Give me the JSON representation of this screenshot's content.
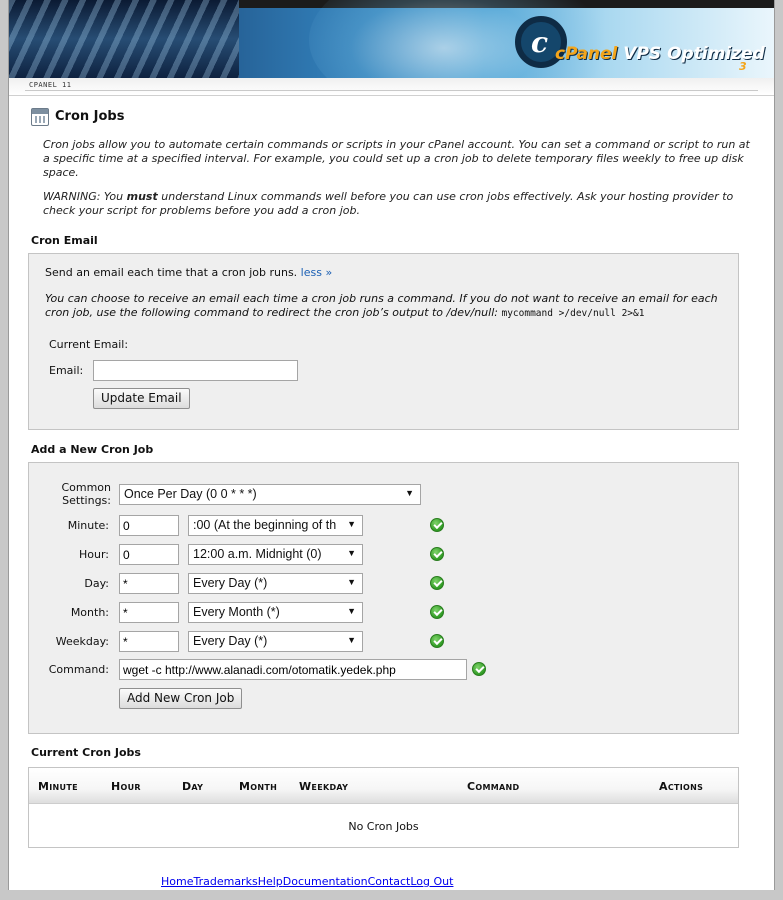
{
  "header": {
    "logo_letter": "c",
    "brand_prefix": "cPanel",
    "brand_suffix": " VPS Optimized",
    "brand_version": "3",
    "cpanel_version_label": "CPANEL 11"
  },
  "page": {
    "title": "Cron Jobs",
    "description": "Cron jobs allow you to automate certain commands or scripts in your cPanel account. You can set a command or script to run at a specific time at a specified interval. For example, you could set up a cron job to delete temporary files weekly to free up disk space.",
    "warning_prefix": "WARNING: You ",
    "warning_emphasis": "must",
    "warning_suffix": " understand Linux commands well before you can use cron jobs effectively. Ask your hosting provider to check your script for problems before you add a cron job."
  },
  "cron_email": {
    "section_title": "Cron Email",
    "intro": "Send an email each time that a cron job runs. ",
    "less_link": "less »",
    "detail": "You can choose to receive an email each time a cron job runs a command. If you do not want to receive an email for each cron job, use the following command to redirect the cron job’s output to /dev/null: ",
    "detail_code": "mycommand >/dev/null 2>&1",
    "current_email_label": "Current Email:",
    "email_label": "Email:",
    "email_value": "",
    "update_button": "Update Email"
  },
  "new_cron": {
    "section_title": "Add a New Cron Job",
    "common_label": "Common Settings:",
    "common_value": "Once Per Day (0 0 * * *)",
    "fields": [
      {
        "label": "Minute:",
        "value": "0",
        "select": ":00 (At the beginning of th"
      },
      {
        "label": "Hour:",
        "value": "0",
        "select": "12:00 a.m. Midnight (0)"
      },
      {
        "label": "Day:",
        "value": "*",
        "select": "Every Day (*)"
      },
      {
        "label": "Month:",
        "value": "*",
        "select": "Every Month (*)"
      },
      {
        "label": "Weekday:",
        "value": "*",
        "select": "Every Day (*)"
      }
    ],
    "command_label": "Command:",
    "command_value": "wget -c http://www.alanadi.com/otomatik.yedek.php",
    "add_button": "Add New Cron Job"
  },
  "current_jobs": {
    "section_title": "Current Cron Jobs",
    "columns": [
      "Minute",
      "Hour",
      "Day",
      "Month",
      "Weekday",
      "Command",
      "Actions"
    ],
    "empty_text": "No Cron Jobs"
  },
  "footer": {
    "links": [
      "Home",
      "Trademarks",
      "Help",
      "Documentation",
      "Contact",
      "Log Out"
    ]
  },
  "colors": {
    "link": "#1a5fb4",
    "panel_bg": "#efefef",
    "ok_green": "#2f9a24",
    "brand_orange": "#f3a51b"
  }
}
